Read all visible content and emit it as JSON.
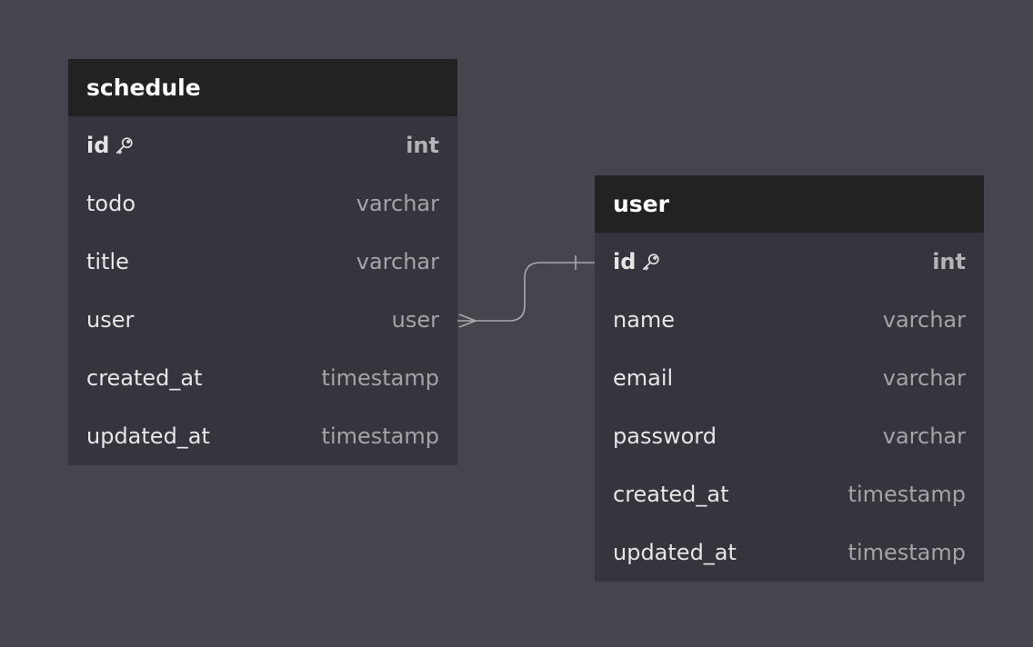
{
  "tables": [
    {
      "name": "schedule",
      "columns": [
        {
          "name": "id",
          "type": "int",
          "primary_key": true,
          "icon": "key-icon"
        },
        {
          "name": "todo",
          "type": "varchar"
        },
        {
          "name": "title",
          "type": "varchar"
        },
        {
          "name": "user",
          "type": "user"
        },
        {
          "name": "created_at",
          "type": "timestamp"
        },
        {
          "name": "updated_at",
          "type": "timestamp"
        }
      ]
    },
    {
      "name": "user",
      "columns": [
        {
          "name": "id",
          "type": "int",
          "primary_key": true,
          "icon": "key-icon"
        },
        {
          "name": "name",
          "type": "varchar"
        },
        {
          "name": "email",
          "type": "varchar"
        },
        {
          "name": "password",
          "type": "varchar"
        },
        {
          "name": "created_at",
          "type": "timestamp"
        },
        {
          "name": "updated_at",
          "type": "timestamp"
        }
      ]
    }
  ],
  "relation": {
    "from": "schedule.user",
    "to": "user.id",
    "from_cardinality": "many",
    "to_cardinality": "one"
  },
  "colors": {
    "background": "#45454d",
    "table_body": "#35353d",
    "table_header": "#222222",
    "column_name": "#e6e6e6",
    "column_type": "#a4a4a8",
    "relation_line": "#aaaaaa"
  }
}
